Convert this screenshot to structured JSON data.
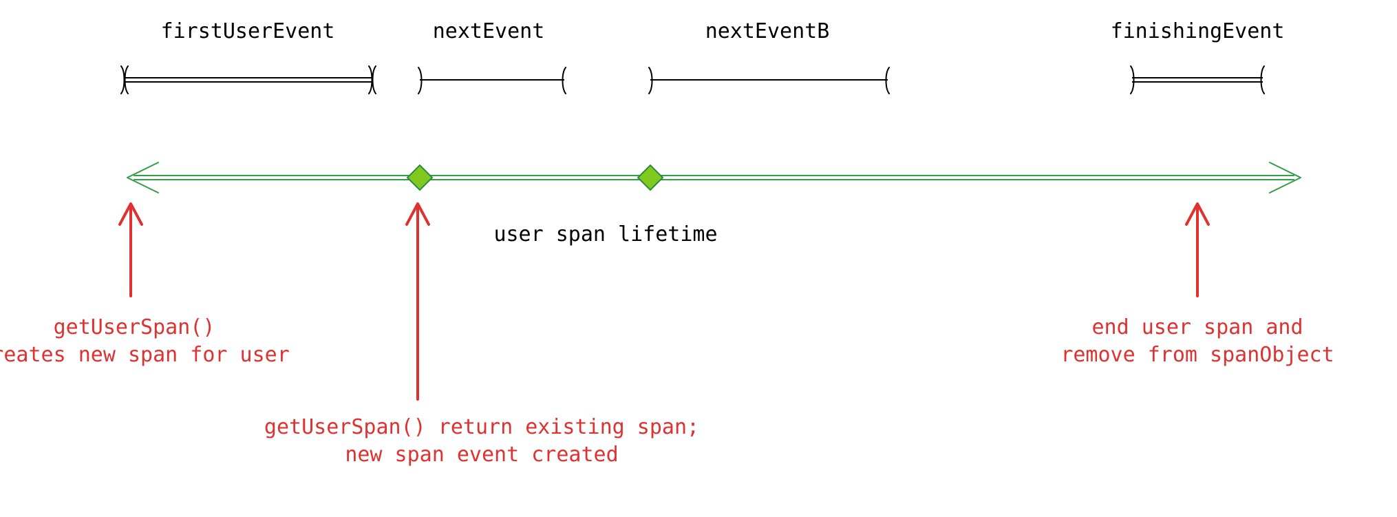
{
  "events": {
    "first": {
      "label": "firstUserEvent"
    },
    "next": {
      "label": "nextEvent"
    },
    "nextB": {
      "label": "nextEventB"
    },
    "finishing": {
      "label": "finishingEvent"
    }
  },
  "timeline": {
    "lifetime_label": "user span lifetime"
  },
  "annotations": {
    "create": {
      "line1": "getUserSpan()",
      "line2": "creates new span for user"
    },
    "existing": {
      "line1": "getUserSpan() return existing span;",
      "line2": "new span event created"
    },
    "end": {
      "line1": "end user span and",
      "line2": "remove from spanObject"
    }
  },
  "colors": {
    "timeline": "#2f9e44",
    "diamond_fill": "#82c91e",
    "diamond_stroke": "#2b8a3e",
    "annotation": "#e03131",
    "text": "#000000"
  }
}
